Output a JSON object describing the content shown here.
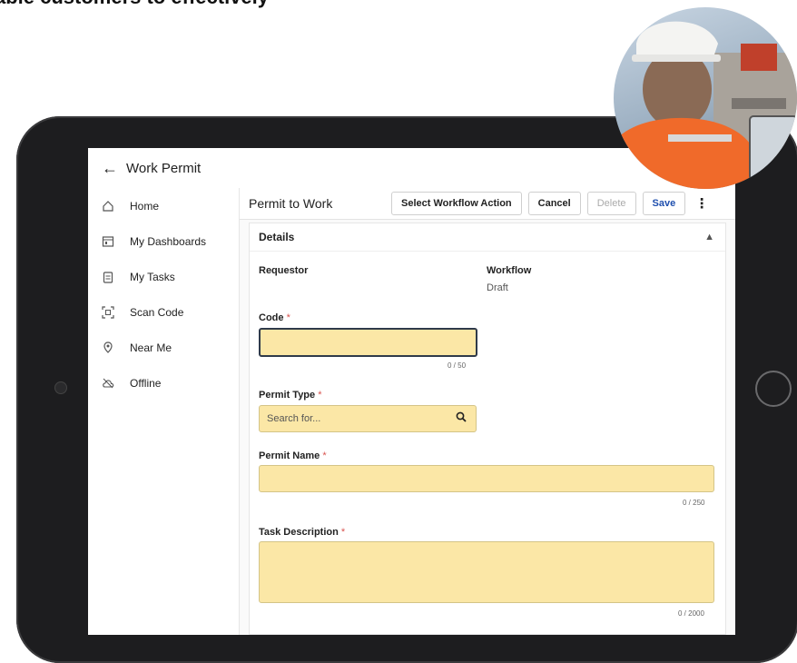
{
  "caption": "able customers to effectively",
  "app": {
    "title": "Work Permit",
    "back_icon": "arrow-left-icon"
  },
  "sidebar": {
    "items": [
      {
        "label": "Home",
        "icon": "home-icon"
      },
      {
        "label": "My Dashboards",
        "icon": "dashboard-icon"
      },
      {
        "label": "My Tasks",
        "icon": "clipboard-icon"
      },
      {
        "label": "Scan Code",
        "icon": "scan-icon"
      },
      {
        "label": "Near Me",
        "icon": "location-icon"
      },
      {
        "label": "Offline",
        "icon": "cloud-offline-icon"
      }
    ]
  },
  "toolbar": {
    "form_title": "Permit to Work",
    "workflow_label": "Select Workflow Action",
    "cancel_label": "Cancel",
    "delete_label": "Delete",
    "save_label": "Save",
    "more_icon": "kebab-menu-icon"
  },
  "details": {
    "section_title": "Details",
    "requestor_label": "Requestor",
    "requestor_value": "",
    "workflow_label": "Workflow",
    "workflow_value": "Draft",
    "code_label": "Code",
    "code_value": "",
    "code_counter": "0 / 50",
    "permit_type_label": "Permit Type",
    "permit_type_placeholder": "Search for...",
    "permit_name_label": "Permit Name",
    "permit_name_value": "",
    "permit_name_counter": "0 / 250",
    "task_description_label": "Task Description",
    "task_description_value": "",
    "task_description_counter": "0 / 2000",
    "required_marker": "*"
  },
  "colors": {
    "input_required_bg": "#fbe7a6",
    "save_text": "#1f4fae",
    "required_asterisk": "#d9534f",
    "tablet_frame": "#1d1d1f"
  }
}
